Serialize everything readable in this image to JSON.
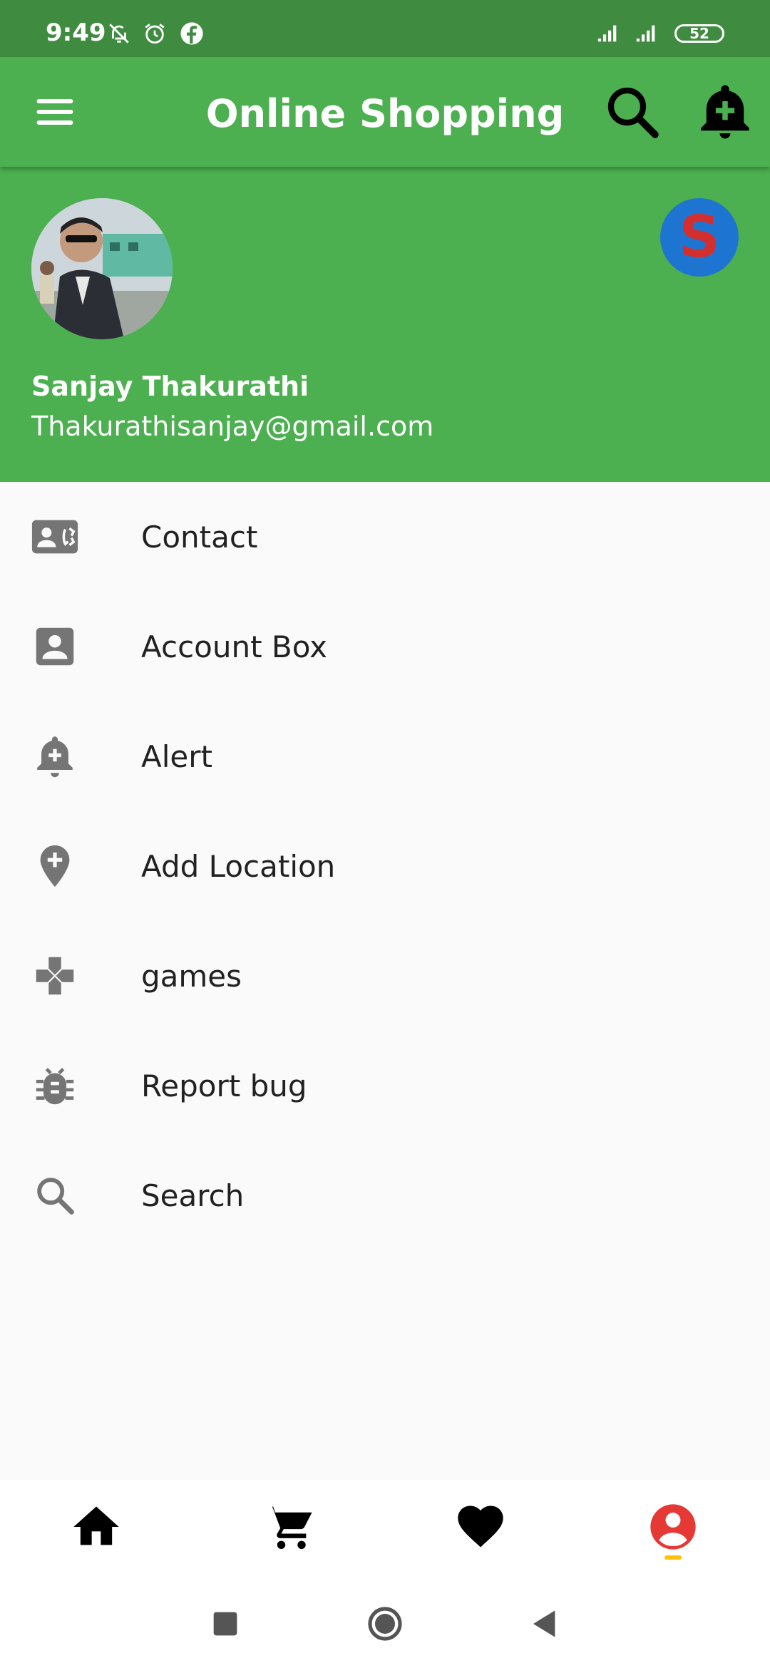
{
  "status_bar": {
    "time": "9:49",
    "battery": "52",
    "icons": [
      "notifications-off-icon",
      "alarm-icon",
      "facebook-icon",
      "signal-icon",
      "signal-icon",
      "battery-icon"
    ]
  },
  "app_bar": {
    "title": "Online Shopping",
    "menu_icon": "menu-icon",
    "search_icon": "search-icon",
    "alert_icon": "add-alert-icon",
    "color": "#4caf50"
  },
  "drawer_header": {
    "name": "Sanjay Thakurathi",
    "email": "Thakurathisanjay@gmail.com",
    "badge_letter": "S",
    "badge_bg": "#1e74d1",
    "badge_fg": "#d32f2f"
  },
  "drawer_items": [
    {
      "label": "Contact",
      "icon": "contact-phone-icon"
    },
    {
      "label": "Account Box",
      "icon": "account-box-icon"
    },
    {
      "label": "Alert",
      "icon": "add-alert-icon"
    },
    {
      "label": "Add Location",
      "icon": "add-location-icon"
    },
    {
      "label": "games",
      "icon": "games-icon"
    },
    {
      "label": "Report bug",
      "icon": "bug-report-icon"
    },
    {
      "label": "Search",
      "icon": "search-icon"
    }
  ],
  "bottom_nav": {
    "items": [
      "home-icon",
      "cart-icon",
      "favorite-icon",
      "account-circle-icon"
    ],
    "selected": "account-circle-icon",
    "selected_color": "#e53935",
    "indicator_color": "#ffc107"
  },
  "system_nav": [
    "recents-icon",
    "home-circle-icon",
    "back-icon"
  ]
}
